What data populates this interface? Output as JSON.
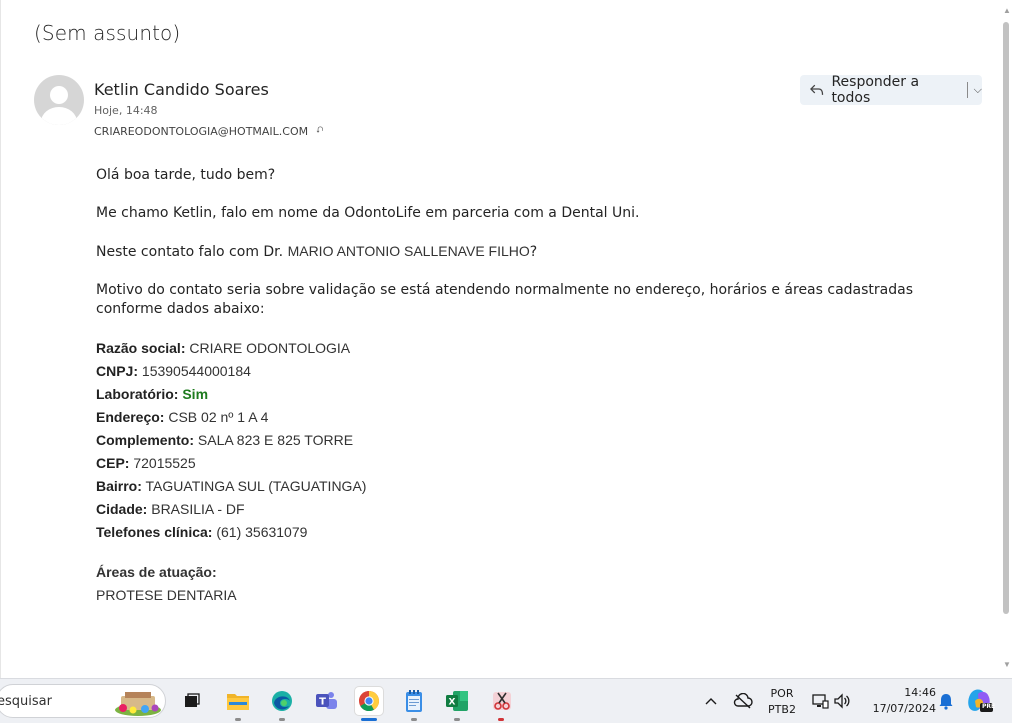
{
  "email": {
    "subject": "(Sem assunto)",
    "sender_name": "Ketlin Candido Soares",
    "sent_time": "Hoje, 14:48",
    "to_address": "CRIAREODONTOLOGIA@HOTMAIL.COM",
    "reply_all_label": "Responder a todos"
  },
  "body": {
    "greeting": "Olá boa tarde, tudo bem?",
    "intro": "Me chamo Ketlin, falo em nome da OdontoLife em parceria com a Dental Uni.",
    "contact_prefix": "Neste contato falo com Dr. ",
    "contact_name": "MARIO ANTONIO SALLENAVE FILHO",
    "contact_suffix": "?",
    "motive": "Motivo do contato seria sobre validação se está atendendo normalmente no endereço, horários e áreas cadastradas conforme dados abaixo:",
    "fields": [
      {
        "label": "Razão social:",
        "value": "CRIARE ODONTOLOGIA"
      },
      {
        "label": "CNPJ:",
        "value": "15390544000184"
      },
      {
        "label": "Laboratório:",
        "value": "Sim"
      },
      {
        "label": "Endereço:",
        "value": "CSB 02 nº 1 A 4"
      },
      {
        "label": "Complemento:",
        "value": "SALA 823 E 825 TORRE"
      },
      {
        "label": "CEP:",
        "value": "72015525"
      },
      {
        "label": "Bairro:",
        "value": "TAGUATINGA SUL (TAGUATINGA)"
      },
      {
        "label": "Cidade:",
        "value": "BRASILIA - DF"
      },
      {
        "label": "Telefones clínica:",
        "value": "(61) 35631079"
      }
    ],
    "areas_label": "Áreas de atuação:",
    "areas_value": "PROTESE DENTARIA"
  },
  "taskbar": {
    "search_text": "esquisar",
    "apps": [
      "file-explorer",
      "edge",
      "teams",
      "chrome",
      "notepad",
      "excel",
      "snipping-tool"
    ],
    "lang_top": "POR",
    "lang_bottom": "PTB2",
    "time": "14:46",
    "date": "17/07/2024",
    "copilot_badge": "PRE"
  },
  "colors": {
    "accent": "#1a6fd4",
    "laboratorio_sim": "#1e7b1e",
    "reply_bg": "#edf2f7"
  }
}
